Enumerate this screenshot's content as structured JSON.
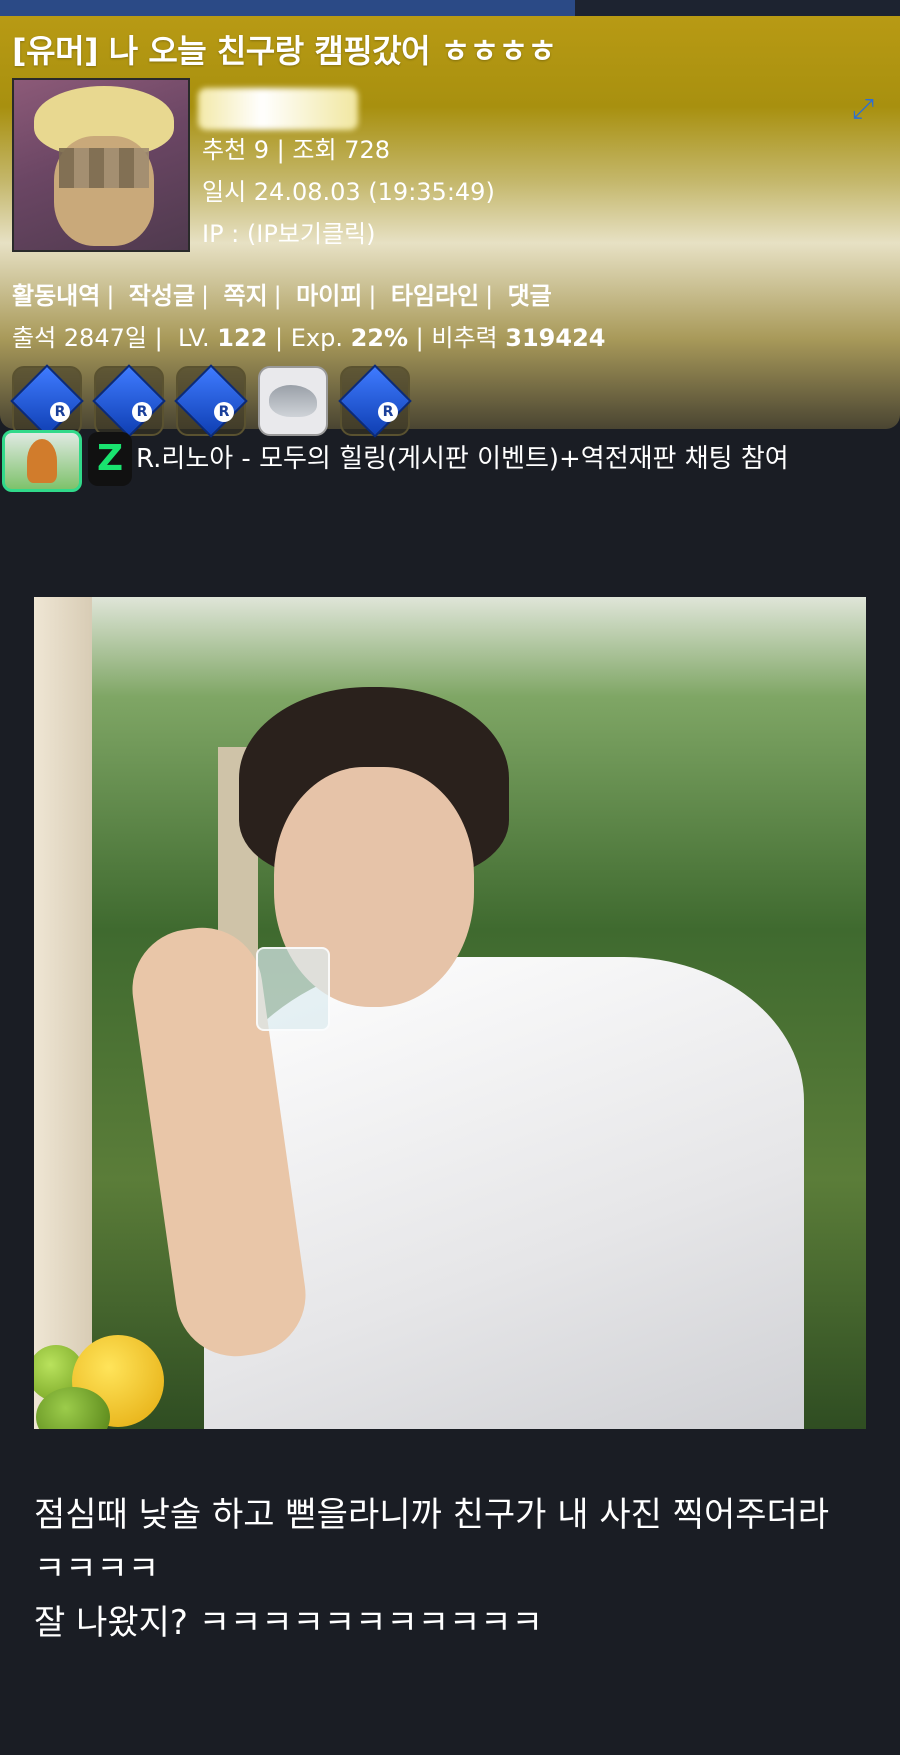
{
  "post": {
    "title": "[유머] 나 오늘 친구랑 캠핑갔어 ㅎㅎㅎㅎ",
    "recommend_views": "추천 9 | 조회 728",
    "date": "일시 24.08.03 (19:35:49)",
    "ip": "IP : (IP보기클릭)"
  },
  "author": {
    "avatar_icon": "mosaic-face-avatar",
    "links": [
      "활동내역",
      "작성글",
      "쪽지",
      "마이피",
      "타임라인",
      "댓글"
    ],
    "attendance": "출석 2847일",
    "level_label": "LV.",
    "level": "122",
    "exp_label": "Exp.",
    "exp": "22%",
    "power_label": "비추력",
    "power": "319424",
    "badges": [
      "blue-gem-r-icon",
      "blue-gem-r-icon",
      "blue-gem-r-icon",
      "dolphin-icon",
      "blue-gem-r-icon"
    ],
    "badge_letter": "R"
  },
  "game": {
    "icon": "game-banner-icon",
    "z_label": "Z",
    "text": "R.리노아 - 모두의 힐링(게시판 이벤트)+역전재판 채팅 참여"
  },
  "content": {
    "image": "man-drinking-in-forest-photo",
    "lines": [
      "점심때 낮술 하고 뻗을라니까 친구가 내 사진 찍어주더라",
      "ㅋㅋㅋㅋ",
      "잘 나왔지? ㅋㅋㅋㅋㅋㅋㅋㅋㅋㅋㅋ"
    ]
  },
  "colors": {
    "background": "#1a1d24",
    "header_gold": "#b89a14",
    "accent_green": "#31d98a"
  }
}
